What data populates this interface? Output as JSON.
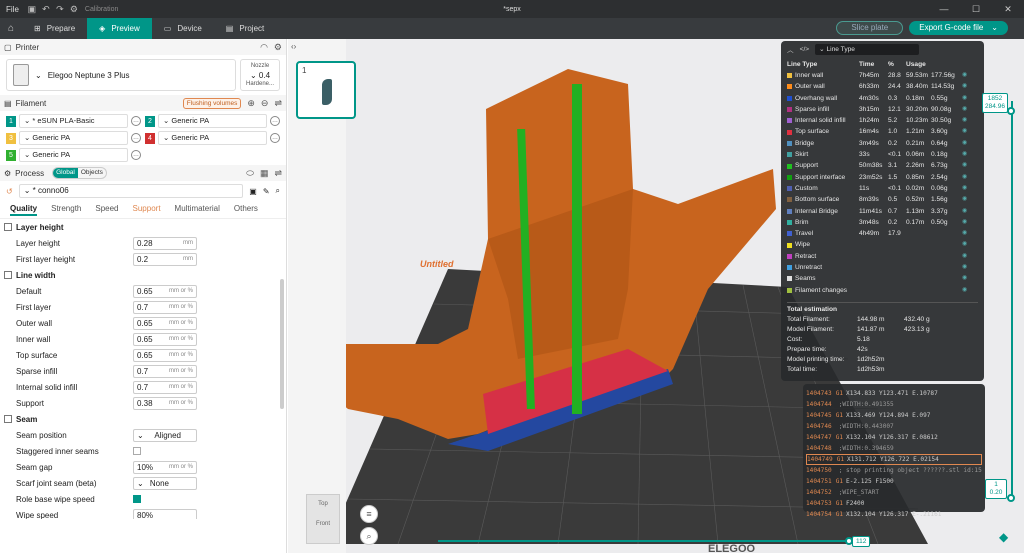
{
  "titlebar": {
    "file": "File",
    "calibration": "Calibration",
    "title": "*sepx"
  },
  "nav": {
    "tabs": [
      "Prepare",
      "Preview",
      "Device",
      "Project"
    ],
    "active": 1,
    "slice": "Slice plate",
    "export": "Export G-code file"
  },
  "printer": {
    "section": "Printer",
    "name": "Elegoo Neptune 3 Plus",
    "nozzle_label": "Nozzle",
    "nozzle_value": "0.4",
    "hardened": "Hardene..."
  },
  "filament": {
    "section": "Filament",
    "flush": "Flushing volumes",
    "items": [
      {
        "num": "1",
        "name": "* eSUN PLA-Basic",
        "color": "#009688"
      },
      {
        "num": "2",
        "name": "Generic PA",
        "color": "#009688"
      },
      {
        "num": "3",
        "name": "Generic PA",
        "color": "#f0c040"
      },
      {
        "num": "4",
        "name": "Generic PA",
        "color": "#d03030"
      },
      {
        "num": "5",
        "name": "Generic PA",
        "color": "#30b030"
      }
    ]
  },
  "process": {
    "section": "Process",
    "global": "Global",
    "objects": "Objects",
    "preset": "* conno06"
  },
  "quality_tabs": [
    "Quality",
    "Strength",
    "Speed",
    "Support",
    "Multimaterial",
    "Others"
  ],
  "settings": {
    "layer_height": {
      "title": "Layer height",
      "rows": [
        {
          "label": "Layer height",
          "value": "0.28",
          "unit": "mm"
        },
        {
          "label": "First layer height",
          "value": "0.2",
          "unit": "mm"
        }
      ]
    },
    "line_width": {
      "title": "Line width",
      "rows": [
        {
          "label": "Default",
          "value": "0.65",
          "unit": "mm or %"
        },
        {
          "label": "First layer",
          "value": "0.7",
          "unit": "mm or %"
        },
        {
          "label": "Outer wall",
          "value": "0.65",
          "unit": "mm or %"
        },
        {
          "label": "Inner wall",
          "value": "0.65",
          "unit": "mm or %"
        },
        {
          "label": "Top surface",
          "value": "0.65",
          "unit": "mm or %"
        },
        {
          "label": "Sparse infill",
          "value": "0.7",
          "unit": "mm or %"
        },
        {
          "label": "Internal solid infill",
          "value": "0.7",
          "unit": "mm or %"
        },
        {
          "label": "Support",
          "value": "0.38",
          "unit": "mm or %"
        }
      ]
    },
    "seam": {
      "title": "Seam",
      "position_label": "Seam position",
      "position_value": "Aligned",
      "staggered": "Staggered inner seams",
      "gap_label": "Seam gap",
      "gap_value": "10%",
      "scarf_label": "Scarf joint seam (beta)",
      "scarf_value": "None",
      "role_label": "Role base wipe speed",
      "wipe_label": "Wipe speed",
      "wipe_value": "80%"
    }
  },
  "thumb": {
    "num": "1"
  },
  "viewport": {
    "plate_label": "Untitled",
    "brand": "ELEGOO",
    "cube_top": "Top",
    "cube_front": "Front"
  },
  "stats": {
    "dropdown": "Line Type",
    "headers": [
      "Line Type",
      "Time",
      "%",
      "Usage"
    ],
    "rows": [
      {
        "name": "Inner wall",
        "time": "7h45m",
        "pct": "28.8",
        "len": "59.53m",
        "wt": "177.56g",
        "color": "#f0c040"
      },
      {
        "name": "Outer wall",
        "time": "6h33m",
        "pct": "24.4",
        "len": "38.40m",
        "wt": "114.53g",
        "color": "#ff8c1a"
      },
      {
        "name": "Overhang wall",
        "time": "4m30s",
        "pct": "0.3",
        "len": "0.18m",
        "wt": "0.55g",
        "color": "#2050d0"
      },
      {
        "name": "Sparse infill",
        "time": "3h15m",
        "pct": "12.1",
        "len": "30.20m",
        "wt": "90.08g",
        "color": "#b03080"
      },
      {
        "name": "Internal solid infill",
        "time": "1h24m",
        "pct": "5.2",
        "len": "10.23m",
        "wt": "30.50g",
        "color": "#a060d0"
      },
      {
        "name": "Top surface",
        "time": "16m4s",
        "pct": "1.0",
        "len": "1.21m",
        "wt": "3.60g",
        "color": "#e03040"
      },
      {
        "name": "Bridge",
        "time": "3m49s",
        "pct": "0.2",
        "len": "0.21m",
        "wt": "0.64g",
        "color": "#5090c0"
      },
      {
        "name": "Skirt",
        "time": "33s",
        "pct": "<0.1",
        "len": "0.06m",
        "wt": "0.18g",
        "color": "#40a0a0"
      },
      {
        "name": "Support",
        "time": "50m38s",
        "pct": "3.1",
        "len": "2.26m",
        "wt": "6.73g",
        "color": "#20c020"
      },
      {
        "name": "Support interface",
        "time": "23m52s",
        "pct": "1.5",
        "len": "0.85m",
        "wt": "2.54g",
        "color": "#10a010"
      },
      {
        "name": "Custom",
        "time": "11s",
        "pct": "<0.1",
        "len": "0.02m",
        "wt": "0.06g",
        "color": "#5060b0"
      },
      {
        "name": "Bottom surface",
        "time": "8m39s",
        "pct": "0.5",
        "len": "0.52m",
        "wt": "1.56g",
        "color": "#806040"
      },
      {
        "name": "Internal Bridge",
        "time": "11m41s",
        "pct": "0.7",
        "len": "1.13m",
        "wt": "3.37g",
        "color": "#6080c0"
      },
      {
        "name": "Brim",
        "time": "3m48s",
        "pct": "0.2",
        "len": "0.17m",
        "wt": "0.50g",
        "color": "#30b0a0"
      },
      {
        "name": "Travel",
        "time": "4h49m",
        "pct": "17.9",
        "len": "",
        "wt": "",
        "color": "#4060d0"
      },
      {
        "name": "Wipe",
        "time": "",
        "pct": "",
        "len": "",
        "wt": "",
        "color": "#f0e020"
      },
      {
        "name": "Retract",
        "time": "",
        "pct": "",
        "len": "",
        "wt": "",
        "color": "#c040c0"
      },
      {
        "name": "Unretract",
        "time": "",
        "pct": "",
        "len": "",
        "wt": "",
        "color": "#40a0e0"
      },
      {
        "name": "Seams",
        "time": "",
        "pct": "",
        "len": "",
        "wt": "",
        "color": "#e0e0e0"
      },
      {
        "name": "Filament changes",
        "time": "",
        "pct": "",
        "len": "",
        "wt": "",
        "color": "#a0c040"
      }
    ],
    "total_title": "Total estimation",
    "totals": [
      {
        "k": "Total Filament:",
        "a": "144.98 m",
        "b": "432.40 g"
      },
      {
        "k": "Model Filament:",
        "a": "141.87 m",
        "b": "423.13 g"
      },
      {
        "k": "Cost:",
        "a": "5.18",
        "b": ""
      },
      {
        "k": "Prepare time:",
        "a": "42s",
        "b": ""
      },
      {
        "k": "Model printing time:",
        "a": "1d2h52m",
        "b": ""
      },
      {
        "k": "Total time:",
        "a": "1d2h53m",
        "b": ""
      }
    ]
  },
  "gcode": [
    {
      "n": "1404743",
      "g": "G1",
      "t": "X134.833 Y123.471 E.10787"
    },
    {
      "n": "1404744",
      "g": "",
      "t": ";WIDTH:0.491355"
    },
    {
      "n": "1404745",
      "g": "G1",
      "t": "X133.469 Y124.894 E.097"
    },
    {
      "n": "1404746",
      "g": "",
      "t": ";WIDTH:0.443007"
    },
    {
      "n": "1404747",
      "g": "G1",
      "t": "X132.104 Y126.317 E.08612"
    },
    {
      "n": "1404748",
      "g": "",
      "t": ";WIDTH:0.394659"
    },
    {
      "n": "1404749",
      "g": "G1",
      "t": "X131.712 Y126.722 E.02154"
    },
    {
      "n": "1404750",
      "g": "",
      "t": "; stop printing object ??????.stl id:1553765"
    },
    {
      "n": "1404751",
      "g": "G1",
      "t": "E-2.125 F1500"
    },
    {
      "n": "1404752",
      "g": "",
      "t": ";WIPE_START"
    },
    {
      "n": "1404753",
      "g": "G1",
      "t": "F2400"
    },
    {
      "n": "1404754",
      "g": "G1",
      "t": "X132.104 Y126.317 E-.21161"
    }
  ],
  "sliders": {
    "v_top_1": "1852",
    "v_top_2": "284.96",
    "v_bot_1": "1",
    "v_bot_2": "0.20",
    "h_val": "112"
  }
}
